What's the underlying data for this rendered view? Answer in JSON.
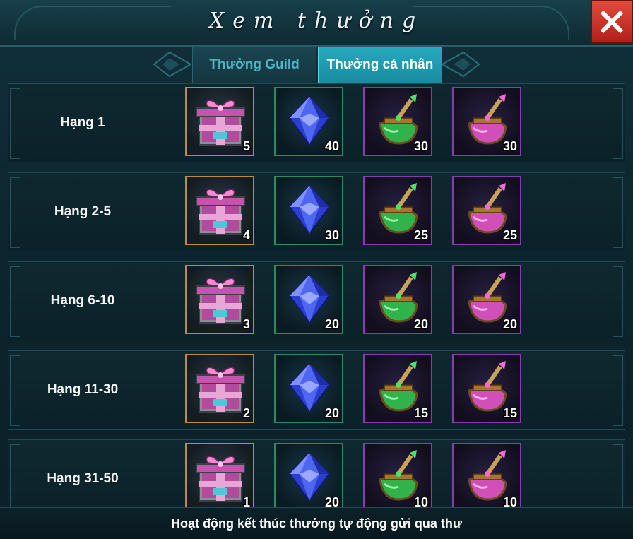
{
  "window": {
    "title": "Xem thưởng"
  },
  "tabs": [
    {
      "label": "Thưởng Guild",
      "active": false
    },
    {
      "label": "Thưởng cá nhân",
      "active": true
    }
  ],
  "rewards": [
    {
      "rank": "Hạng 1",
      "items": [
        {
          "icon": "gift-chest-icon",
          "quantity": "5"
        },
        {
          "icon": "blue-gem-icon",
          "quantity": "40"
        },
        {
          "icon": "green-potion-icon",
          "quantity": "30"
        },
        {
          "icon": "pink-potion-icon",
          "quantity": "30"
        }
      ]
    },
    {
      "rank": "Hạng 2-5",
      "items": [
        {
          "icon": "gift-chest-icon",
          "quantity": "4"
        },
        {
          "icon": "blue-gem-icon",
          "quantity": "30"
        },
        {
          "icon": "green-potion-icon",
          "quantity": "25"
        },
        {
          "icon": "pink-potion-icon",
          "quantity": "25"
        }
      ]
    },
    {
      "rank": "Hạng 6-10",
      "items": [
        {
          "icon": "gift-chest-icon",
          "quantity": "3"
        },
        {
          "icon": "blue-gem-icon",
          "quantity": "20"
        },
        {
          "icon": "green-potion-icon",
          "quantity": "20"
        },
        {
          "icon": "pink-potion-icon",
          "quantity": "20"
        }
      ]
    },
    {
      "rank": "Hạng 11-30",
      "items": [
        {
          "icon": "gift-chest-icon",
          "quantity": "2"
        },
        {
          "icon": "blue-gem-icon",
          "quantity": "20"
        },
        {
          "icon": "green-potion-icon",
          "quantity": "15"
        },
        {
          "icon": "pink-potion-icon",
          "quantity": "15"
        }
      ]
    },
    {
      "rank": "Hạng 31-50",
      "items": [
        {
          "icon": "gift-chest-icon",
          "quantity": "1"
        },
        {
          "icon": "blue-gem-icon",
          "quantity": "20"
        },
        {
          "icon": "green-potion-icon",
          "quantity": "10"
        },
        {
          "icon": "pink-potion-icon",
          "quantity": "10"
        }
      ]
    }
  ],
  "footer": {
    "note": "Hoạt động kết thúc thưởng tự động gửi qua thư"
  },
  "colors": {
    "tab_active": "#27a9bf",
    "close_button": "#c8302a"
  }
}
